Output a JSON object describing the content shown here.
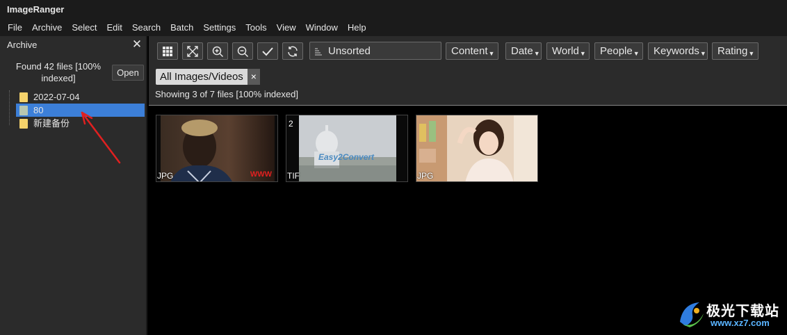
{
  "app": {
    "title": "ImageRanger"
  },
  "menu": [
    "File",
    "Archive",
    "Select",
    "Edit",
    "Search",
    "Batch",
    "Settings",
    "Tools",
    "View",
    "Window",
    "Help"
  ],
  "left_panel": {
    "title": "Archive",
    "found_text": "Found 42 files [100% indexed]",
    "open_label": "Open",
    "tree": [
      {
        "label": "2022-07-04",
        "selected": false
      },
      {
        "label": "80",
        "selected": true
      },
      {
        "label": "新建备份",
        "selected": false
      }
    ]
  },
  "toolbar": {
    "sort_label": "Unsorted",
    "filters": [
      "Content",
      "Date",
      "World",
      "People",
      "Keywords",
      "Rating"
    ]
  },
  "tag": {
    "label": "All Images/Videos",
    "close": "×"
  },
  "status": {
    "showing": "Showing 3 of 7 files [100% indexed]"
  },
  "thumbnails": [
    {
      "format": "JPG",
      "count": "",
      "watermark": "WWW"
    },
    {
      "format": "TIF",
      "count": "2",
      "watermark": "Easy2Convert"
    },
    {
      "format": "JPG",
      "count": "",
      "watermark": ""
    }
  ],
  "logo": {
    "text": "极光下载站",
    "url": "www.xz7.com"
  },
  "colors": {
    "accent": "#3c7fd8",
    "panel": "#2b2b2b",
    "arrow": "#e02020"
  }
}
